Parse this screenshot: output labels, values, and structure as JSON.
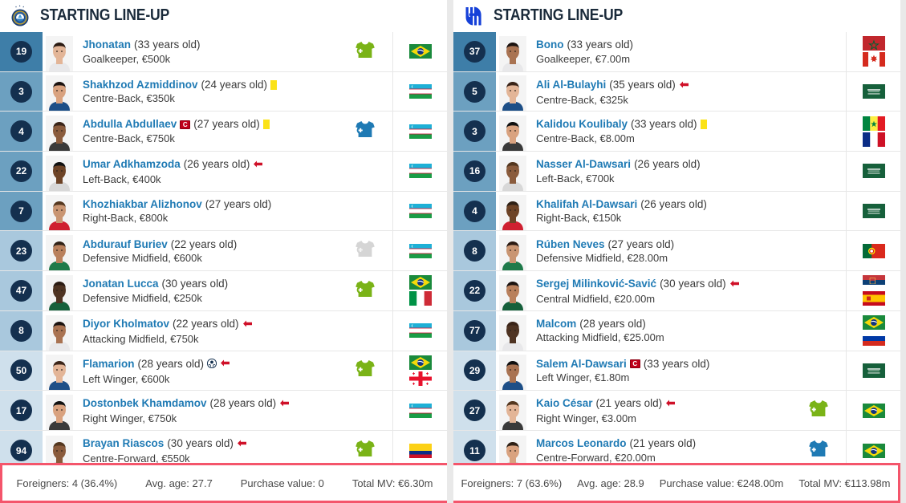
{
  "page": {
    "background": "#e9e9e9",
    "accent_blue": "#1f7ab4",
    "badge_navy": "#14304f",
    "footer_outline": "#f4556b"
  },
  "teams": [
    {
      "side": "left",
      "crest_icon": "pakhtakor-crest-icon",
      "header_title": "STARTING LINE-UP",
      "players": [
        {
          "number": "19",
          "name": "Jhonatan",
          "age": "(33 years old)",
          "position_value": "Goalkeeper, €500k",
          "captain": false,
          "yellow_card": false,
          "goal": false,
          "sub_off": false,
          "sub_icon": "sub-on",
          "nations": [
            "Brazil"
          ],
          "num_shade": "#3e7ea8"
        },
        {
          "number": "3",
          "name": "Shakhzod Azmiddinov",
          "age": "(24 years old)",
          "position_value": "Centre-Back, €350k",
          "captain": false,
          "yellow_card": true,
          "goal": false,
          "sub_off": false,
          "sub_icon": "none",
          "nations": [
            "Uzbekistan"
          ],
          "num_shade": "#6ca0c0"
        },
        {
          "number": "4",
          "name": "Abdulla Abdullaev",
          "age": "(27 years old)",
          "position_value": "Centre-Back, €750k",
          "captain": true,
          "yellow_card": true,
          "goal": false,
          "sub_off": false,
          "sub_icon": "sub-off",
          "nations": [
            "Uzbekistan"
          ],
          "num_shade": "#6ca0c0"
        },
        {
          "number": "22",
          "name": "Umar Adkhamzoda",
          "age": "(26 years old)",
          "position_value": "Left-Back, €400k",
          "captain": false,
          "yellow_card": false,
          "goal": false,
          "sub_off": true,
          "sub_icon": "none",
          "nations": [
            "Uzbekistan"
          ],
          "num_shade": "#6ca0c0"
        },
        {
          "number": "7",
          "name": "Khozhiakbar Alizhonov",
          "age": "(27 years old)",
          "position_value": "Right-Back, €800k",
          "captain": false,
          "yellow_card": false,
          "goal": false,
          "sub_off": false,
          "sub_icon": "none",
          "nations": [
            "Uzbekistan"
          ],
          "num_shade": "#6ca0c0"
        },
        {
          "number": "23",
          "name": "Abdurauf Buriev",
          "age": "(22 years old)",
          "position_value": "Defensive Midfield, €600k",
          "captain": false,
          "yellow_card": false,
          "goal": false,
          "sub_off": false,
          "sub_icon": "sub-faded",
          "nations": [
            "Uzbekistan"
          ],
          "num_shade": "#a9c8dd"
        },
        {
          "number": "47",
          "name": "Jonatan Lucca",
          "age": "(30 years old)",
          "position_value": "Defensive Midfield, €250k",
          "captain": false,
          "yellow_card": false,
          "goal": false,
          "sub_off": false,
          "sub_icon": "sub-on",
          "nations": [
            "Brazil",
            "Italy"
          ],
          "num_shade": "#a9c8dd"
        },
        {
          "number": "8",
          "name": "Diyor Kholmatov",
          "age": "(22 years old)",
          "position_value": "Attacking Midfield, €750k",
          "captain": false,
          "yellow_card": false,
          "goal": false,
          "sub_off": true,
          "sub_icon": "none",
          "nations": [
            "Uzbekistan"
          ],
          "num_shade": "#a9c8dd"
        },
        {
          "number": "50",
          "name": "Flamarion",
          "age": "(28 years old)",
          "position_value": "Left Winger, €600k",
          "captain": false,
          "yellow_card": false,
          "goal": true,
          "sub_off": true,
          "sub_icon": "sub-on",
          "nations": [
            "Brazil",
            "Georgia"
          ],
          "num_shade": "#cfe0ec"
        },
        {
          "number": "17",
          "name": "Dostonbek Khamdamov",
          "age": "(28 years old)",
          "position_value": "Right Winger, €750k",
          "captain": false,
          "yellow_card": false,
          "goal": false,
          "sub_off": true,
          "sub_icon": "none",
          "nations": [
            "Uzbekistan"
          ],
          "num_shade": "#cfe0ec"
        },
        {
          "number": "94",
          "name": "Brayan Riascos",
          "age": "(30 years old)",
          "position_value": "Centre-Forward, €550k",
          "captain": false,
          "yellow_card": false,
          "goal": false,
          "sub_off": true,
          "sub_icon": "sub-on",
          "nations": [
            "Colombia"
          ],
          "num_shade": "#cfe0ec"
        }
      ],
      "footer": {
        "foreigners": "Foreigners: 4 (36.4%)",
        "avg_age": "Avg. age: 27.7",
        "purchase_value": "Purchase value: 0",
        "total_mv": "Total MV: €6.30m"
      }
    },
    {
      "side": "right",
      "crest_icon": "al-hilal-crest-icon",
      "header_title": "STARTING LINE-UP",
      "players": [
        {
          "number": "37",
          "name": "Bono",
          "age": "(33 years old)",
          "position_value": "Goalkeeper, €7.00m",
          "captain": false,
          "yellow_card": false,
          "goal": false,
          "sub_off": false,
          "sub_icon": "none",
          "nations": [
            "Morocco",
            "Canada"
          ],
          "num_shade": "#3e7ea8"
        },
        {
          "number": "5",
          "name": "Ali Al-Bulayhi",
          "age": "(35 years old)",
          "position_value": "Centre-Back, €325k",
          "captain": false,
          "yellow_card": false,
          "goal": false,
          "sub_off": true,
          "sub_icon": "none",
          "nations": [
            "Saudi Arabia"
          ],
          "num_shade": "#6ca0c0"
        },
        {
          "number": "3",
          "name": "Kalidou Koulibaly",
          "age": "(33 years old)",
          "position_value": "Centre-Back, €8.00m",
          "captain": false,
          "yellow_card": true,
          "goal": false,
          "sub_off": false,
          "sub_icon": "none",
          "nations": [
            "Senegal",
            "France"
          ],
          "num_shade": "#6ca0c0"
        },
        {
          "number": "16",
          "name": "Nasser Al-Dawsari",
          "age": "(26 years old)",
          "position_value": "Left-Back, €700k",
          "captain": false,
          "yellow_card": false,
          "goal": false,
          "sub_off": false,
          "sub_icon": "none",
          "nations": [
            "Saudi Arabia"
          ],
          "num_shade": "#6ca0c0"
        },
        {
          "number": "4",
          "name": "Khalifah Al-Dawsari",
          "age": "(26 years old)",
          "position_value": "Right-Back, €150k",
          "captain": false,
          "yellow_card": false,
          "goal": false,
          "sub_off": false,
          "sub_icon": "none",
          "nations": [
            "Saudi Arabia"
          ],
          "num_shade": "#6ca0c0"
        },
        {
          "number": "8",
          "name": "Rúben Neves",
          "age": "(27 years old)",
          "position_value": "Defensive Midfield, €28.00m",
          "captain": false,
          "yellow_card": false,
          "goal": false,
          "sub_off": false,
          "sub_icon": "none",
          "nations": [
            "Portugal"
          ],
          "num_shade": "#a9c8dd"
        },
        {
          "number": "22",
          "name": "Sergej Milinković-Savić",
          "age": "(30 years old)",
          "position_value": "Central Midfield, €20.00m",
          "captain": false,
          "yellow_card": false,
          "goal": false,
          "sub_off": true,
          "sub_icon": "none",
          "nations": [
            "Serbia",
            "Spain"
          ],
          "num_shade": "#a9c8dd"
        },
        {
          "number": "77",
          "name": "Malcom",
          "age": "(28 years old)",
          "position_value": "Attacking Midfield, €25.00m",
          "captain": false,
          "yellow_card": false,
          "goal": false,
          "sub_off": false,
          "sub_icon": "none",
          "nations": [
            "Brazil",
            "Russia"
          ],
          "num_shade": "#a9c8dd"
        },
        {
          "number": "29",
          "name": "Salem Al-Dawsari",
          "age": "(33 years old)",
          "position_value": "Left Winger, €1.80m",
          "captain": true,
          "yellow_card": false,
          "goal": false,
          "sub_off": false,
          "sub_icon": "none",
          "nations": [
            "Saudi Arabia"
          ],
          "num_shade": "#cfe0ec"
        },
        {
          "number": "27",
          "name": "Kaio César",
          "age": "(21 years old)",
          "position_value": "Right Winger, €3.00m",
          "captain": false,
          "yellow_card": false,
          "goal": false,
          "sub_off": true,
          "sub_icon": "sub-on",
          "nations": [
            "Brazil"
          ],
          "num_shade": "#cfe0ec"
        },
        {
          "number": "11",
          "name": "Marcos Leonardo",
          "age": "(21 years old)",
          "position_value": "Centre-Forward, €20.00m",
          "captain": false,
          "yellow_card": false,
          "goal": false,
          "sub_off": false,
          "sub_icon": "sub-off",
          "nations": [
            "Brazil"
          ],
          "num_shade": "#cfe0ec"
        }
      ],
      "footer": {
        "foreigners": "Foreigners: 7 (63.6%)",
        "avg_age": "Avg. age: 28.9",
        "purchase_value": "Purchase value: €248.00m",
        "total_mv": "Total MV: €113.98m"
      }
    }
  ]
}
